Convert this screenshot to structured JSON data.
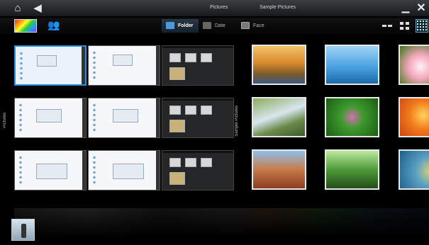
{
  "titlebar": {
    "breadcrumb": [
      "Pictures",
      "Sample Pictures"
    ]
  },
  "toolbar": {
    "tabs": [
      {
        "label": "Folder",
        "active": true
      },
      {
        "label": "Date",
        "active": false
      },
      {
        "label": "Face",
        "active": false
      }
    ],
    "views": [
      "large-thumbnails",
      "medium-thumbnails",
      "small-thumbnails"
    ],
    "active_view": "small-thumbnails"
  },
  "groups": [
    {
      "label": "Pictures",
      "selected_item": 1
    },
    {
      "label": "Sample Pictures"
    }
  ],
  "icons": {
    "home": "home-icon",
    "back": "back-arrow-icon",
    "minimize": "minimize-icon",
    "close": "close-icon",
    "people": "people-icon",
    "folder": "folder-icon",
    "date": "calendar-icon",
    "face": "face-icon"
  },
  "colors": {
    "accent": "#2d8de0",
    "titlebar": "#2a2d31",
    "background": "#000000"
  }
}
